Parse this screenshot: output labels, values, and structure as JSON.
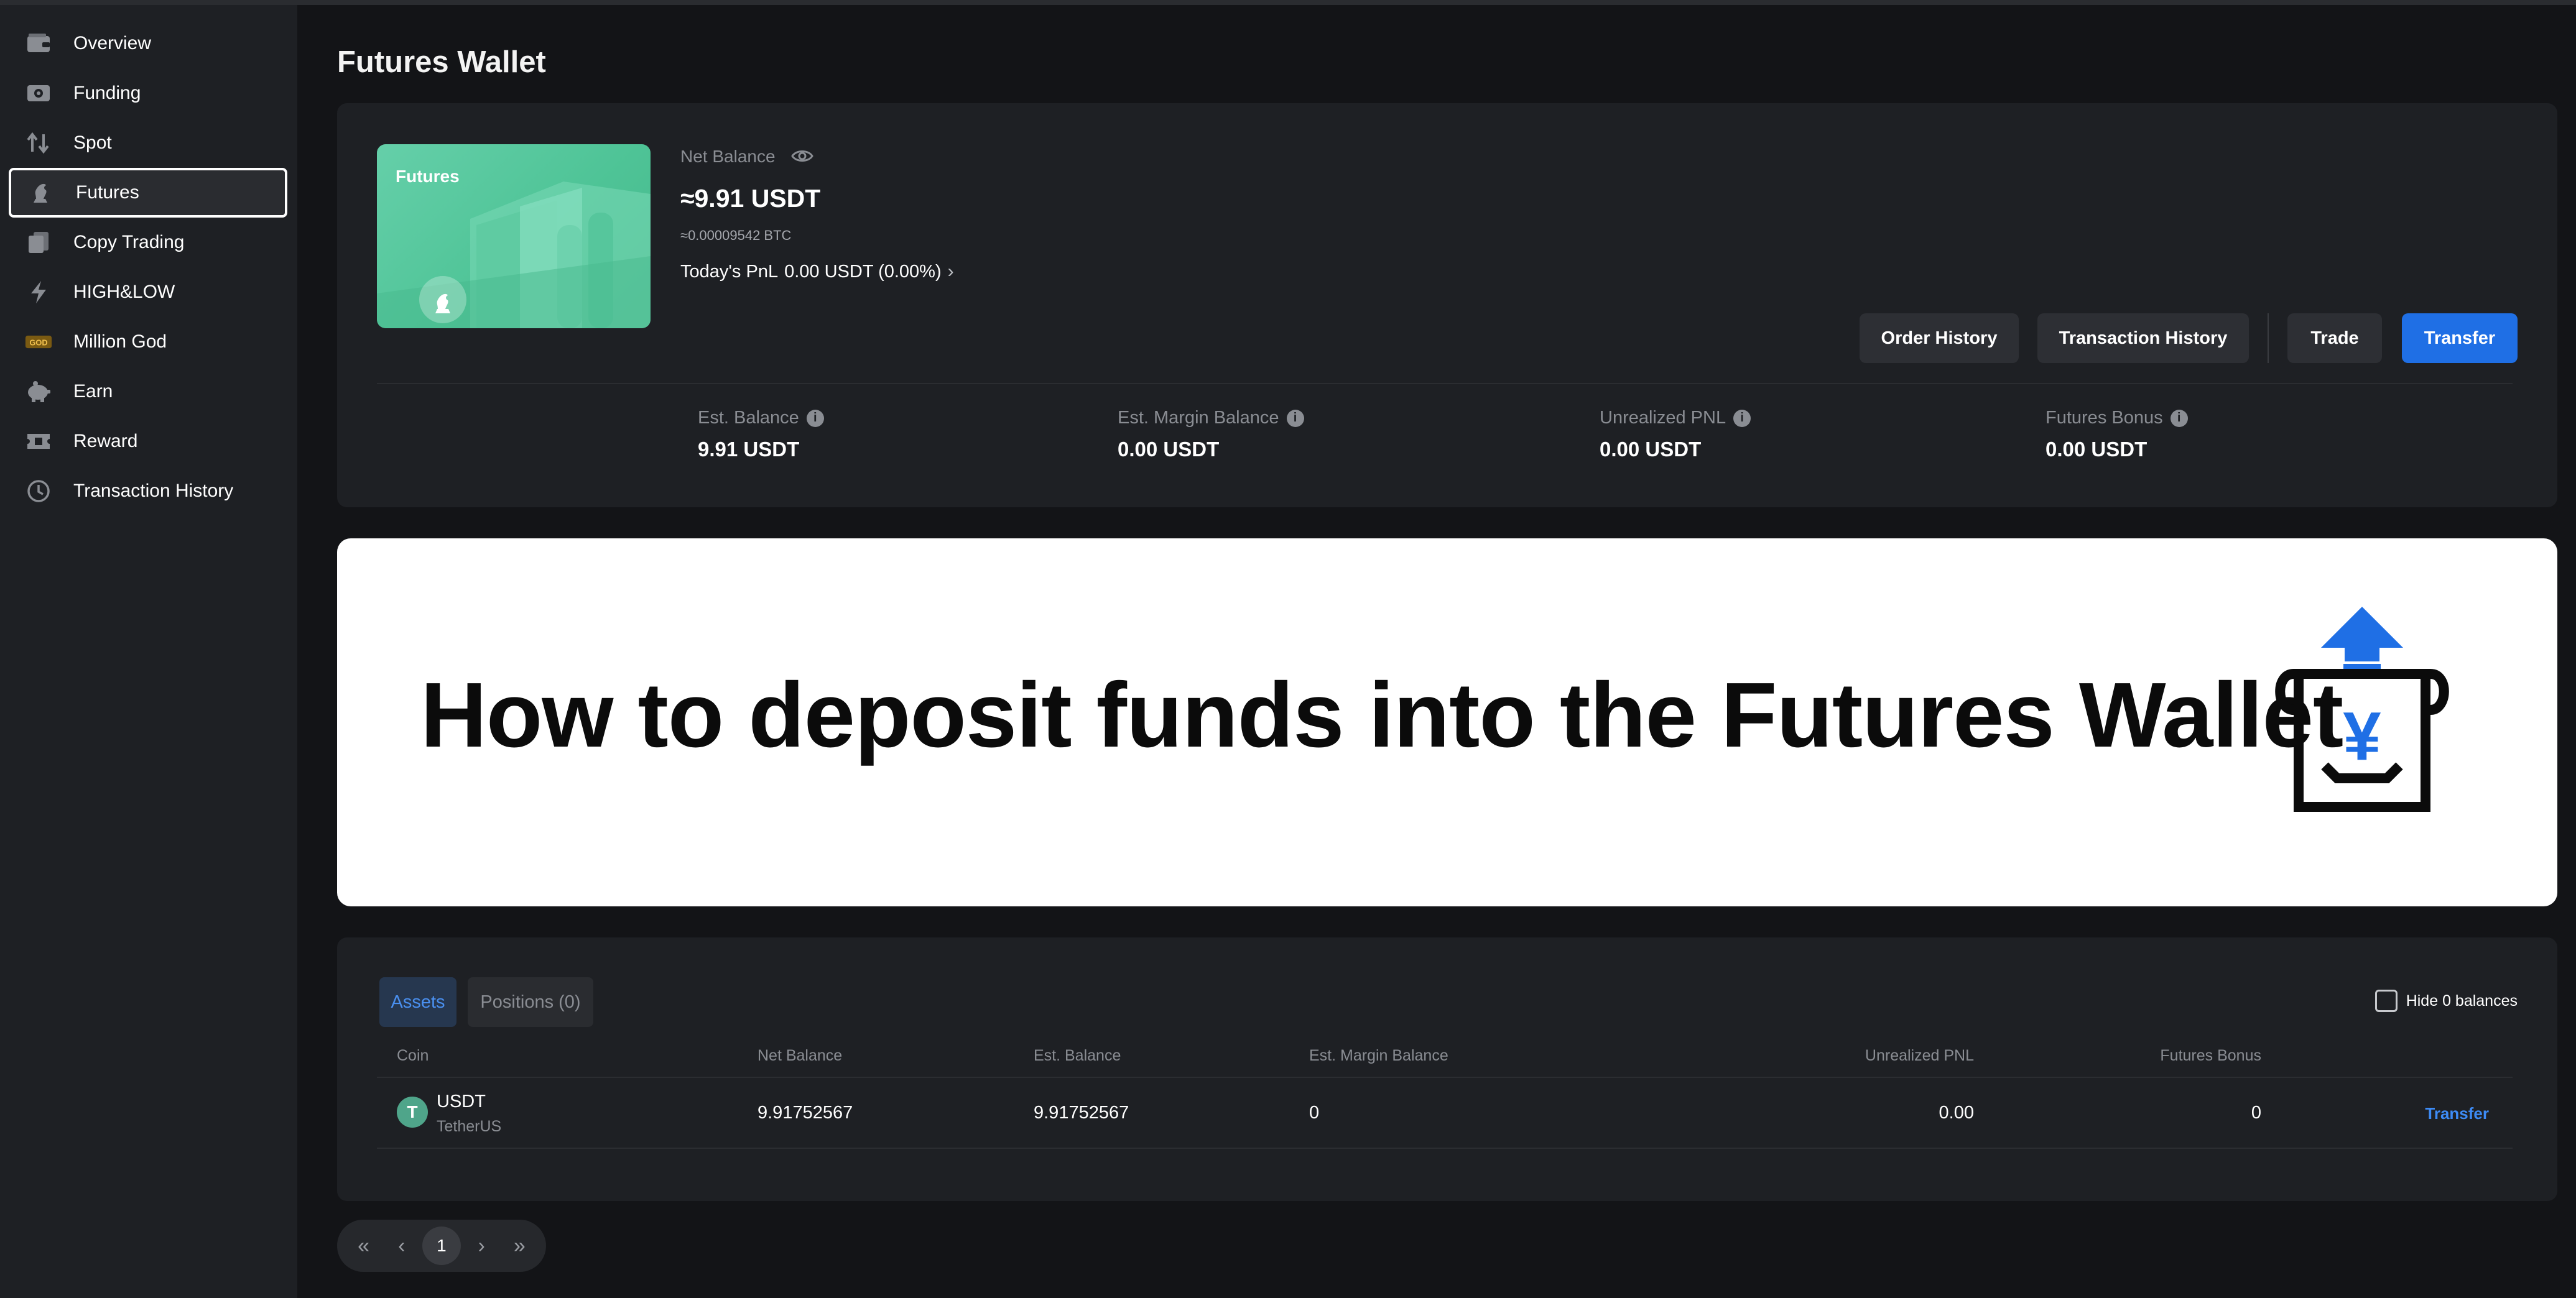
{
  "sidebar": {
    "items": [
      {
        "label": "Overview",
        "icon": "wallet-icon"
      },
      {
        "label": "Funding",
        "icon": "funding-icon"
      },
      {
        "label": "Spot",
        "icon": "spot-arrows-icon"
      },
      {
        "label": "Futures",
        "icon": "futures-icon",
        "active": true
      },
      {
        "label": "Copy Trading",
        "icon": "copy-trading-icon"
      },
      {
        "label": "HIGH&LOW",
        "icon": "lightning-icon"
      },
      {
        "label": "Million God",
        "icon": "million-god-icon"
      },
      {
        "label": "Earn",
        "icon": "piggy-bank-icon"
      },
      {
        "label": "Reward",
        "icon": "ticket-icon"
      },
      {
        "label": "Transaction History",
        "icon": "clock-icon"
      }
    ]
  },
  "page": {
    "title": "Futures Wallet"
  },
  "wallet": {
    "card_title": "Futures",
    "net_balance_label": "Net Balance",
    "net_balance_value": "≈9.91 USDT",
    "net_balance_btc": "≈0.00009542 BTC",
    "pnl_label": "Today's PnL",
    "pnl_value": "0.00 USDT (0.00%)",
    "buttons": {
      "order_history": "Order History",
      "transaction_history": "Transaction History",
      "trade": "Trade",
      "transfer": "Transfer"
    },
    "stats": [
      {
        "label": "Est. Balance",
        "value": "9.91 USDT"
      },
      {
        "label": "Est. Margin Balance",
        "value": "0.00 USDT"
      },
      {
        "label": "Unrealized PNL",
        "value": "0.00 USDT"
      },
      {
        "label": "Futures Bonus",
        "value": "0.00 USDT"
      }
    ]
  },
  "banner": {
    "text": "How to deposit funds into the Futures Wallet",
    "symbol": "¥"
  },
  "assets": {
    "tabs": [
      {
        "label": "Assets"
      },
      {
        "label": "Positions (0)"
      }
    ],
    "hide_zero_label": "Hide 0 balances",
    "columns": [
      "Coin",
      "Net Balance",
      "Est. Balance",
      "Est. Margin Balance",
      "Unrealized PNL",
      "Futures Bonus"
    ],
    "rows": [
      {
        "coin": "USDT",
        "coin_full": "TetherUS",
        "coin_icon_glyph": "T",
        "net_balance": "9.91752567",
        "est_balance": "9.91752567",
        "est_margin_balance": "0",
        "unrealized_pnl": "0.00",
        "futures_bonus": "0",
        "action": "Transfer"
      }
    ]
  },
  "pagination": {
    "current": "1"
  },
  "colors": {
    "accent": "#1f6fe5",
    "card_green": "#55c89e",
    "bg": "#131417",
    "panel": "#1e2024"
  }
}
